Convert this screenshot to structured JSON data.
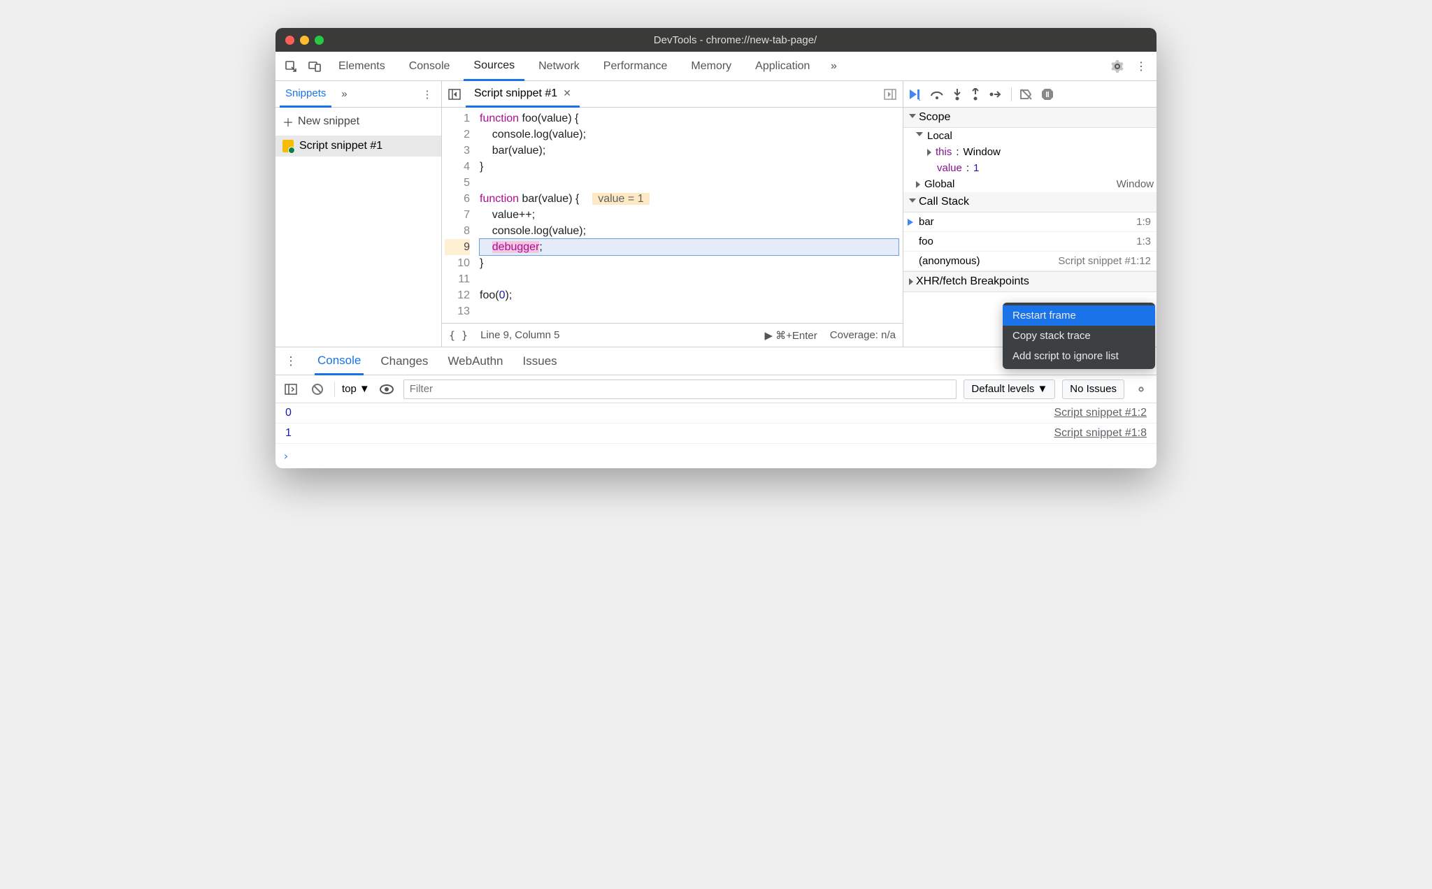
{
  "window": {
    "title": "DevTools - chrome://new-tab-page/"
  },
  "mainTabs": {
    "items": [
      "Elements",
      "Console",
      "Sources",
      "Network",
      "Performance",
      "Memory",
      "Application"
    ],
    "active": "Sources"
  },
  "sidebar": {
    "tab": "Snippets",
    "newSnippet": "New snippet",
    "items": [
      {
        "label": "Script snippet #1"
      }
    ]
  },
  "editor": {
    "tab": "Script snippet #1",
    "lines": [
      {
        "n": 1,
        "html": "<span class='kw'>function</span> foo(value) {"
      },
      {
        "n": 2,
        "html": "    console.log(value);"
      },
      {
        "n": 3,
        "html": "    bar(value);"
      },
      {
        "n": 4,
        "html": "}"
      },
      {
        "n": 5,
        "html": ""
      },
      {
        "n": 6,
        "html": "<span class='kw'>function</span> bar(value) {  <span class='hint'>value = 1</span>"
      },
      {
        "n": 7,
        "html": "    value++;"
      },
      {
        "n": 8,
        "html": "    console.log(value);"
      },
      {
        "n": 9,
        "html": "    <span class='dbg'>debugger</span>;",
        "highlight": true
      },
      {
        "n": 10,
        "html": "}"
      },
      {
        "n": 11,
        "html": ""
      },
      {
        "n": 12,
        "html": "foo(<span class='num'>0</span>);"
      },
      {
        "n": 13,
        "html": ""
      }
    ],
    "inlineHint": "value = 1",
    "status": {
      "cursor": "Line 9, Column 5",
      "run": "⌘+Enter",
      "coverage": "Coverage: n/a"
    }
  },
  "debug": {
    "scope": {
      "title": "Scope",
      "local": {
        "label": "Local",
        "this": "this",
        "thisVal": "Window",
        "varName": "value",
        "varVal": "1"
      },
      "global": {
        "label": "Global",
        "val": "Window"
      }
    },
    "callStack": {
      "title": "Call Stack",
      "frames": [
        {
          "fn": "bar",
          "loc": "1:9",
          "active": true
        },
        {
          "fn": "foo",
          "loc": "1:3"
        },
        {
          "fn": "(anonymous)",
          "locFull": "Script snippet #1:12"
        }
      ]
    },
    "xhr": "XHR/fetch Breakpoints",
    "contextMenu": {
      "items": [
        "Restart frame",
        "Copy stack trace",
        "Add script to ignore list"
      ],
      "selected": 0
    }
  },
  "drawer": {
    "tabs": [
      "Console",
      "Changes",
      "WebAuthn",
      "Issues"
    ],
    "active": "Console",
    "toolbar": {
      "context": "top",
      "filterPlaceholder": "Filter",
      "levels": "Default levels",
      "issues": "No Issues"
    },
    "logs": [
      {
        "val": "0",
        "loc": "Script snippet #1:2"
      },
      {
        "val": "1",
        "loc": "Script snippet #1:8"
      }
    ]
  }
}
